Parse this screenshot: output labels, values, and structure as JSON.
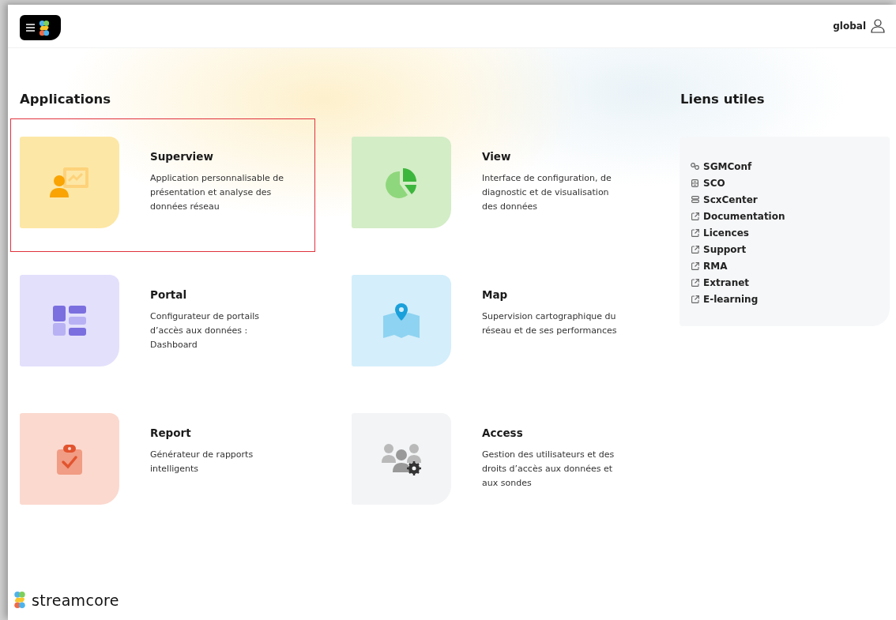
{
  "header": {
    "username": "global"
  },
  "applications": {
    "title": "Applications",
    "items": [
      {
        "name": "Superview",
        "description": "Application personnalisable de présentation et analyse des données réseau",
        "color": "#fde7a6",
        "selected": true
      },
      {
        "name": "View",
        "description": "Interface de configuration, de diagnostic et de visualisation des données",
        "color": "#d3edc6",
        "selected": false
      },
      {
        "name": "Portal",
        "description": "Configurateur de portails d’accès aux données : Dashboard",
        "color": "#e3e0fc",
        "selected": false
      },
      {
        "name": "Map",
        "description": "Supervision cartographique du réseau et de ses performances",
        "color": "#d4eefb",
        "selected": false
      },
      {
        "name": "Report",
        "description": "Générateur de rapports intelligents",
        "color": "#fbd9cf",
        "selected": false
      },
      {
        "name": "Access",
        "description": "Gestion des utilisateurs et des droits d’accès aux données et aux sondes",
        "color": "#f3f4f6",
        "selected": false
      }
    ]
  },
  "useful_links": {
    "title": "Liens utiles",
    "items": [
      {
        "label": "SGMConf",
        "kind": "chain"
      },
      {
        "label": "SCO",
        "kind": "server"
      },
      {
        "label": "ScxCenter",
        "kind": "stack"
      },
      {
        "label": "Documentation",
        "kind": "external"
      },
      {
        "label": "Licences",
        "kind": "external"
      },
      {
        "label": "Support",
        "kind": "external"
      },
      {
        "label": "RMA",
        "kind": "external"
      },
      {
        "label": "Extranet",
        "kind": "external"
      },
      {
        "label": "E-learning",
        "kind": "external"
      }
    ]
  },
  "footer": {
    "brand": "streamcore"
  }
}
